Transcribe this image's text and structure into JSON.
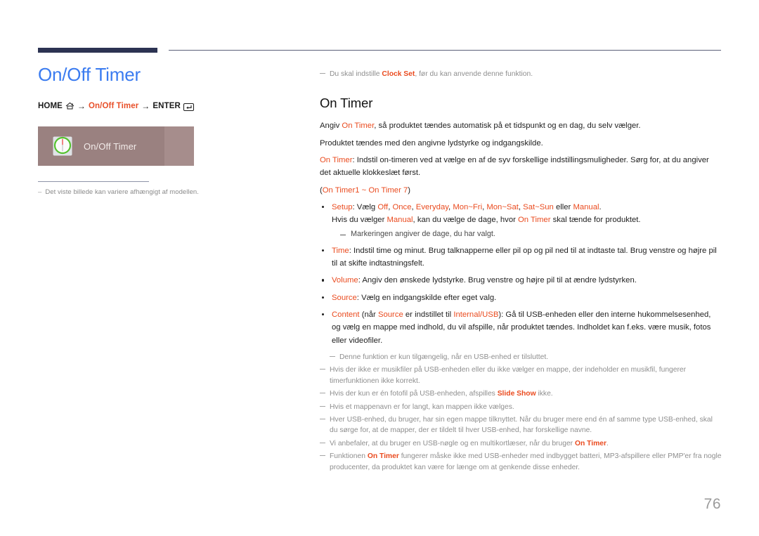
{
  "header": {
    "rule_color_thick": "#2c3352",
    "rule_color_thin": "#5b6078"
  },
  "left": {
    "title": "On/Off Timer",
    "breadcrumb": {
      "home_label": "HOME",
      "home_icon": "home-icon",
      "arrow": "→",
      "menu_label": "On/Off Timer",
      "enter_label": "ENTER",
      "enter_icon": "enter-key-icon"
    },
    "thumbnail": {
      "label": "On/Off Timer",
      "icon": "timer-dial-icon",
      "background": "#9a8180",
      "panel_background": "#a68d8c"
    },
    "note": {
      "dash": "–",
      "text": "Det viste billede kan variere afhængigt af modellen."
    }
  },
  "right": {
    "top_note": {
      "before": "Du skal indstille ",
      "accent": "Clock Set",
      "after": ", før du kan anvende denne funktion."
    },
    "heading": "On Timer",
    "paragraphs": {
      "p1_a": "Angiv ",
      "p1_accent": "On Timer",
      "p1_b": ", så produktet tændes automatisk på et tidspunkt og en dag, du selv vælger.",
      "p2": "Produktet tændes med den angivne lydstyrke og indgangskilde.",
      "p3_accent": "On Timer",
      "p3_text": ": Indstil on-timeren ved at vælge en af de syv forskellige indstillingsmuligheder. Sørg for, at du angiver det aktuelle klokkeslæt først.",
      "p4_open": "(",
      "p4_a": "On Timer1",
      "p4_mid": " ~ ",
      "p4_b": "On Timer 7",
      "p4_close": ")"
    },
    "bullets": {
      "setup": {
        "label": "Setup",
        "line1_a": ": Vælg ",
        "opt1": "Off",
        "opt2": "Once",
        "opt3": "Everyday",
        "opt4": "Mon~Fri",
        "opt5": "Mon~Sat",
        "opt6": "Sat~Sun",
        "line1_or": " eller ",
        "opt7": "Manual",
        "line1_end": ".",
        "line2_a": "Hvis du vælger ",
        "line2_accent1": "Manual",
        "line2_b": ", kan du vælge de dage, hvor ",
        "line2_accent2": "On Timer",
        "line2_c": " skal tænde for produktet.",
        "subnote_dash": "–",
        "subnote": "Markeringen angiver de dage, du har valgt."
      },
      "time": {
        "label": "Time",
        "text": ": Indstil time og minut. Brug talknapperne eller pil op og pil ned til at indtaste tal. Brug venstre og højre pil til at skifte indtastningsfelt."
      },
      "volume": {
        "label": "Volume",
        "text": ": Angiv den ønskede lydstyrke. Brug venstre og højre pil til at ændre lydstyrken."
      },
      "source": {
        "label": "Source",
        "text": ": Vælg en indgangskilde efter eget valg."
      },
      "content": {
        "label": "Content",
        "a": " (når ",
        "accent1": "Source",
        "b": " er indstillet til ",
        "accent2": "Internal/USB",
        "c": "): Gå til USB-enheden eller den interne hukommelsesenhed, og vælg en mappe med indhold, du vil afspille, når produktet tændes. Indholdet kan f.eks. være musik, fotos eller videofiler."
      }
    },
    "notes": {
      "n1": "Denne funktion er kun tilgængelig, når en USB-enhed er tilsluttet.",
      "n2": "Hvis der ikke er musikfiler på USB-enheden eller du ikke vælger en mappe, der indeholder en musikfil, fungerer timerfunktionen ikke korrekt.",
      "n3_a": "Hvis der kun er én fotofil på USB-enheden, afspilles ",
      "n3_accent": "Slide Show",
      "n3_b": " ikke.",
      "n4": "Hvis et mappenavn er for langt, kan mappen ikke vælges.",
      "n5": "Hver USB-enhed, du bruger, har sin egen mappe tilknyttet. Når du bruger mere end én af samme type USB-enhed, skal du sørge for, at de mapper, der er tildelt til hver USB-enhed, har forskellige navne.",
      "n6_a": "Vi anbefaler, at du bruger en USB-nøgle og en multikortlæser, når du bruger ",
      "n6_accent": "On Timer",
      "n6_b": ".",
      "n7_a": "Funktionen ",
      "n7_accent": "On Timer",
      "n7_b": " fungerer måske ikke med USB-enheder med indbygget batteri, MP3-afspillere eller PMP'er fra nogle producenter, da produktet kan være for længe om at genkende disse enheder."
    }
  },
  "footer": {
    "page_number": "76"
  },
  "colors": {
    "title_blue": "#3a7bf0",
    "accent_orange": "#ea4b1f",
    "note_gray": "#8e8e8e",
    "navy": "#2c3352"
  }
}
